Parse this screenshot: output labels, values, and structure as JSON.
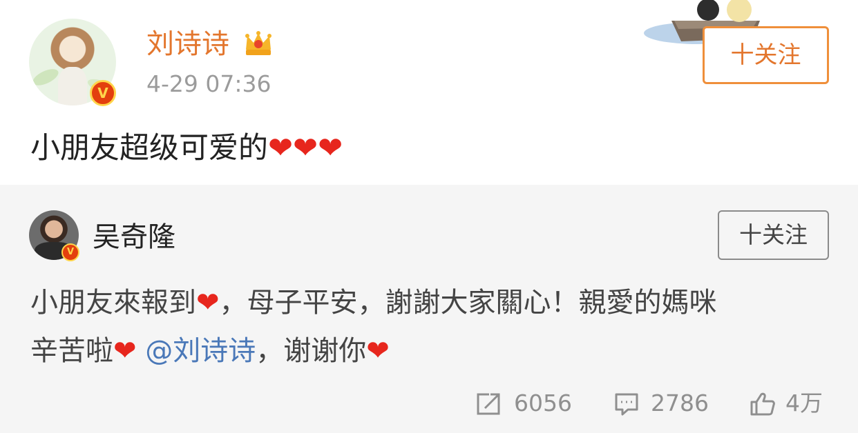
{
  "post": {
    "author": "刘诗诗",
    "time": "4-29 07:36",
    "follow_label": "十关注",
    "text": "小朋友超级可爱的",
    "text_hearts": [
      "❤",
      "❤",
      "❤"
    ],
    "badge_letter": "V"
  },
  "repost": {
    "author": "吴奇隆",
    "follow_label": "十关注",
    "badge_letter": "V",
    "line1_a": "小朋友來報到",
    "line1_b": "，母子平安，謝謝大家關心！親愛的媽咪",
    "line2_a": "辛苦啦",
    "mention": "@刘诗诗",
    "line2_b": "，谢谢你",
    "heart": "❤"
  },
  "stats": {
    "reposts": "6056",
    "comments": "2786",
    "likes": "4万"
  },
  "colors": {
    "author_orange": "#e3762d",
    "follow_border": "#ef8f3a",
    "mention_blue": "#4a78b8",
    "heart_red": "#e7261d",
    "repost_bg": "#f5f5f5"
  },
  "icons": [
    "crown-icon",
    "verified-icon",
    "repost-icon",
    "comment-icon",
    "like-icon"
  ]
}
